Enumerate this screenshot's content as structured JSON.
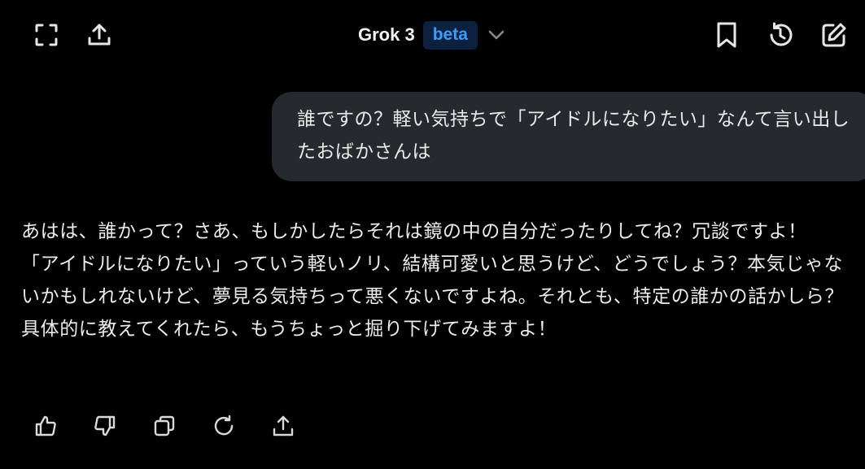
{
  "header": {
    "model_name": "Grok 3",
    "badge": "beta",
    "icons": {
      "left": [
        "fullscreen-icon",
        "share-icon"
      ],
      "right": [
        "bookmark-icon",
        "history-icon",
        "edit-icon"
      ]
    }
  },
  "conversation": {
    "user_message": "誰ですの？軽い気持ちで「アイドルになりたい」なんて言い出したおばかさんは",
    "assistant_message": "あはは、誰かって？さあ、もしかしたらそれは鏡の中の自分だったりしてね？冗談ですよ！「アイドルになりたい」っていう軽いノリ、結構可愛いと思うけど、どうでしょう？本気じゃないかもしれないけど、夢見る気持ちって悪くないですよね。それとも、特定の誰かの話かしら？具体的に教えてくれたら、もうちょっと掘り下げてみますよ！"
  },
  "actions": [
    "thumbs-up-icon",
    "thumbs-down-icon",
    "copy-icon",
    "regenerate-icon",
    "share-icon"
  ],
  "colors": {
    "background": "#000000",
    "bubble": "#26292d",
    "badge_bg": "#0c2140",
    "badge_text": "#3b9bff",
    "text": "#ececec",
    "icon": "#d9d9d9"
  }
}
